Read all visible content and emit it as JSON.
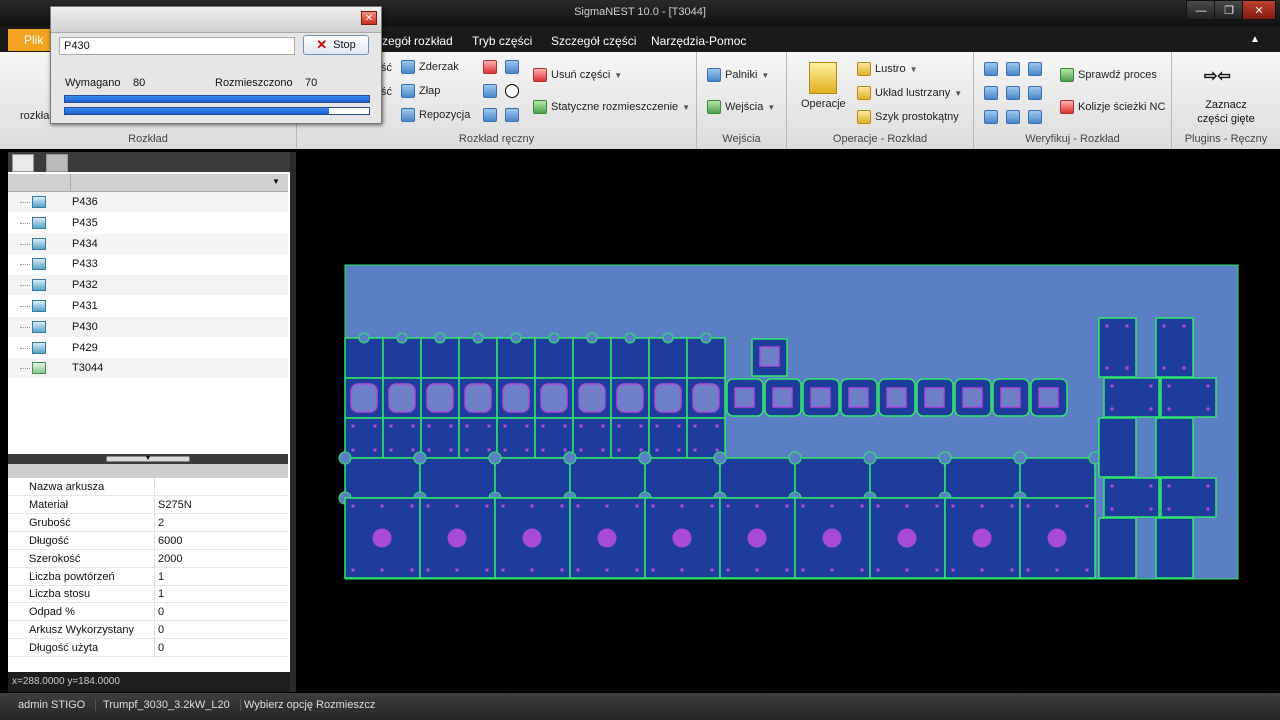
{
  "window": {
    "title": "SigmaNEST 10.0 - [T3044]",
    "minimize": "—",
    "maximize": "❐",
    "close": "✕"
  },
  "menu": {
    "file": "Plik",
    "items": [
      "zczegół rozkład",
      "Tryb części",
      "Szczegół części",
      "Narzędzia-Pomoc"
    ]
  },
  "ribbon": {
    "groups": [
      {
        "label": "Rozkład",
        "buttons": [
          "rozkład"
        ]
      },
      {
        "label": "Rozkład ręczny",
        "buttons": [
          "ść",
          "ść",
          "Zderzak",
          "Złap",
          "Repozycja",
          "Usuń części",
          "Statyczne rozmieszczenie"
        ]
      },
      {
        "label": "Wejścia",
        "buttons": [
          "Palniki",
          "Wejścia"
        ]
      },
      {
        "label": "Operacje - Rozkład",
        "buttons": [
          "Operacje",
          "Lustro",
          "Układ lustrzany",
          "Szyk prostokątny"
        ]
      },
      {
        "label": "Weryfikuj - Rozkład",
        "buttons": [
          "Sprawdź proces",
          "Kolizje ścieżki NC"
        ]
      },
      {
        "label": "Plugins - Ręczny",
        "buttons": [
          "Zaznacz",
          "części gięte"
        ]
      }
    ]
  },
  "dialog": {
    "part": "P430",
    "stop_label": "Stop",
    "required_label": "Wymagano",
    "required_value": "80",
    "placed_label": "Rozmieszczono",
    "placed_value": "70",
    "progress_top": 1.0,
    "progress_bottom": 0.87
  },
  "tree": {
    "items": [
      "P436",
      "P435",
      "P434",
      "P433",
      "P432",
      "P431",
      "P430",
      "P429",
      "T3044"
    ]
  },
  "properties": [
    {
      "key": "Nazwa arkusza",
      "value": ""
    },
    {
      "key": "Materiał",
      "value": "S275N"
    },
    {
      "key": "Grubość",
      "value": "2"
    },
    {
      "key": "Długość",
      "value": "6000"
    },
    {
      "key": "Szerokość",
      "value": "2000"
    },
    {
      "key": "Liczba powtórzeń",
      "value": "1"
    },
    {
      "key": "Liczba stosu",
      "value": "1"
    },
    {
      "key": "Odpad %",
      "value": "0"
    },
    {
      "key": "Arkusz Wykorzystany",
      "value": "0"
    },
    {
      "key": "Długość użyta",
      "value": "0"
    }
  ],
  "coords": "x=288.0000 y=184.0000",
  "status": {
    "user": "admin STIGO",
    "machine": "Trumpf_3030_3.2kW_L20",
    "hint": "Wybierz opcję Rozmieszcz"
  },
  "colors": {
    "sheet": "#5b7fc4",
    "part": "#1e3c9c",
    "outline": "#2ee86a",
    "hole": "#a84ad8",
    "accent": "#f1a321"
  }
}
